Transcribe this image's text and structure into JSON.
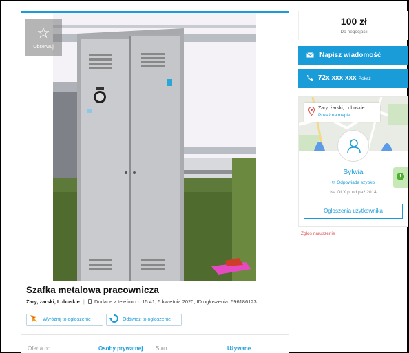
{
  "listing": {
    "observe_label": "Obserwuj",
    "title": "Szafka metalowa pracownicza",
    "location": "Żary, żarski, Lubuskie",
    "added": "Dodane z telefonu",
    "added_time": "o 15:41, 5 kwietnia 2020, ID ogłoszenia: 596186123",
    "promote_label": "Wyróżnij to ogłoszenie",
    "refresh_label": "Odśwież to ogłoszenie",
    "details": [
      {
        "label": "Oferta od",
        "value": "Osoby prywatnej"
      },
      {
        "label": "Stan",
        "value": "Używane"
      }
    ]
  },
  "sidebar": {
    "price": "100 zł",
    "negotiable": "Do negocjacji",
    "message_button": "Napisz wiadomość",
    "phone_masked": "72x xxx xxx",
    "phone_show": "Pokaż",
    "location": "Żary, żarski, Lubuskie",
    "map_link": "Pokaż na mapie",
    "seller_name": "Sylwia",
    "seller_fast": "Odpowiada szybko",
    "seller_since": "Na OLX.pl od paź 2014",
    "user_ads_button": "Ogłoszenia użytkownika",
    "report_link": "Zgłoś naruszenie",
    "badge_icon": "!"
  },
  "colors": {
    "accent": "#1a9cd8",
    "report": "#d9534f",
    "badge": "#4caf2f"
  },
  "icons": [
    "star-icon",
    "phone-small-icon",
    "promote-icon",
    "refresh-icon",
    "envelope-icon",
    "phone-icon",
    "map-pin-icon",
    "user-icon",
    "speech-icon",
    "alert-icon"
  ]
}
